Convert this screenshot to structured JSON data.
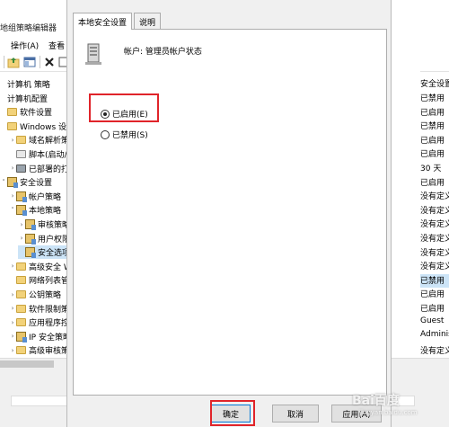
{
  "background": {
    "window_title": "地组策略编辑器",
    "menu": [
      "操作(A)",
      "查看"
    ],
    "tree": [
      {
        "label": "计算机 策略",
        "indent": 0,
        "arrow": "",
        "icon": "none"
      },
      {
        "label": "计算机配置",
        "indent": 0,
        "arrow": "",
        "icon": "none"
      },
      {
        "label": "软件设置",
        "indent": 0,
        "arrow": "",
        "icon": "folder"
      },
      {
        "label": "Windows 设置",
        "indent": 0,
        "arrow": "",
        "icon": "folder"
      },
      {
        "label": "域名解析策略",
        "indent": 1,
        "arrow": ">",
        "icon": "folder"
      },
      {
        "label": "脚本(启动/关机)",
        "indent": 1,
        "arrow": "",
        "icon": "doc"
      },
      {
        "label": "已部署的打印机",
        "indent": 1,
        "arrow": ">",
        "icon": "printer"
      },
      {
        "label": "安全设置",
        "indent": 0,
        "arrow": "v",
        "icon": "sec"
      },
      {
        "label": "帐户策略",
        "indent": 1,
        "arrow": ">",
        "icon": "sec"
      },
      {
        "label": "本地策略",
        "indent": 1,
        "arrow": "v",
        "icon": "sec"
      },
      {
        "label": "审核策略",
        "indent": 2,
        "arrow": ">",
        "icon": "sec"
      },
      {
        "label": "用户权限分配",
        "indent": 2,
        "arrow": ">",
        "icon": "sec"
      },
      {
        "label": "安全选项",
        "indent": 2,
        "arrow": "",
        "icon": "sec",
        "selected": true
      },
      {
        "label": "高级安全 Windows",
        "indent": 1,
        "arrow": ">",
        "icon": "folder"
      },
      {
        "label": "网络列表管理器策略",
        "indent": 1,
        "arrow": "",
        "icon": "folder"
      },
      {
        "label": "公钥策略",
        "indent": 1,
        "arrow": ">",
        "icon": "folder"
      },
      {
        "label": "软件限制策略",
        "indent": 1,
        "arrow": ">",
        "icon": "folder"
      },
      {
        "label": "应用程序控制策略",
        "indent": 1,
        "arrow": ">",
        "icon": "folder"
      },
      {
        "label": "IP 安全策略",
        "indent": 1,
        "arrow": ">",
        "icon": "sec"
      },
      {
        "label": "高级审核策略配置",
        "indent": 1,
        "arrow": ">",
        "icon": "folder"
      }
    ],
    "settings_header": "安全设置",
    "settings_values": [
      {
        "v": "已禁用"
      },
      {
        "v": "已启用"
      },
      {
        "v": "已禁用"
      },
      {
        "v": "已启用"
      },
      {
        "v": "已启用"
      },
      {
        "v": "30 天"
      },
      {
        "v": "已启用"
      },
      {
        "v": "没有定义"
      },
      {
        "v": "没有定义"
      },
      {
        "v": "没有定义"
      },
      {
        "v": "没有定义"
      },
      {
        "v": "没有定义"
      },
      {
        "v": "没有定义"
      },
      {
        "v": "已禁用",
        "selected": true
      },
      {
        "v": "已启用"
      },
      {
        "v": "已启用"
      },
      {
        "v": "Guest"
      },
      {
        "v": "Administrator"
      },
      {
        "v": "没有定义"
      }
    ]
  },
  "dialog": {
    "tabs": [
      "本地安全设置",
      "说明"
    ],
    "policy_title": "帐户: 管理员帐户状态",
    "options": {
      "enabled": "已启用(E)",
      "disabled": "已禁用(S)",
      "selected": "enabled"
    },
    "buttons": {
      "ok": "确定",
      "cancel": "取消",
      "apply": "应用(A)"
    }
  },
  "watermark": {
    "brand": "Bai百度",
    "sub": "jingyan.baidu.com"
  },
  "colors": {
    "highlight_box": "#e0242a",
    "selection": "#cce4f7"
  }
}
